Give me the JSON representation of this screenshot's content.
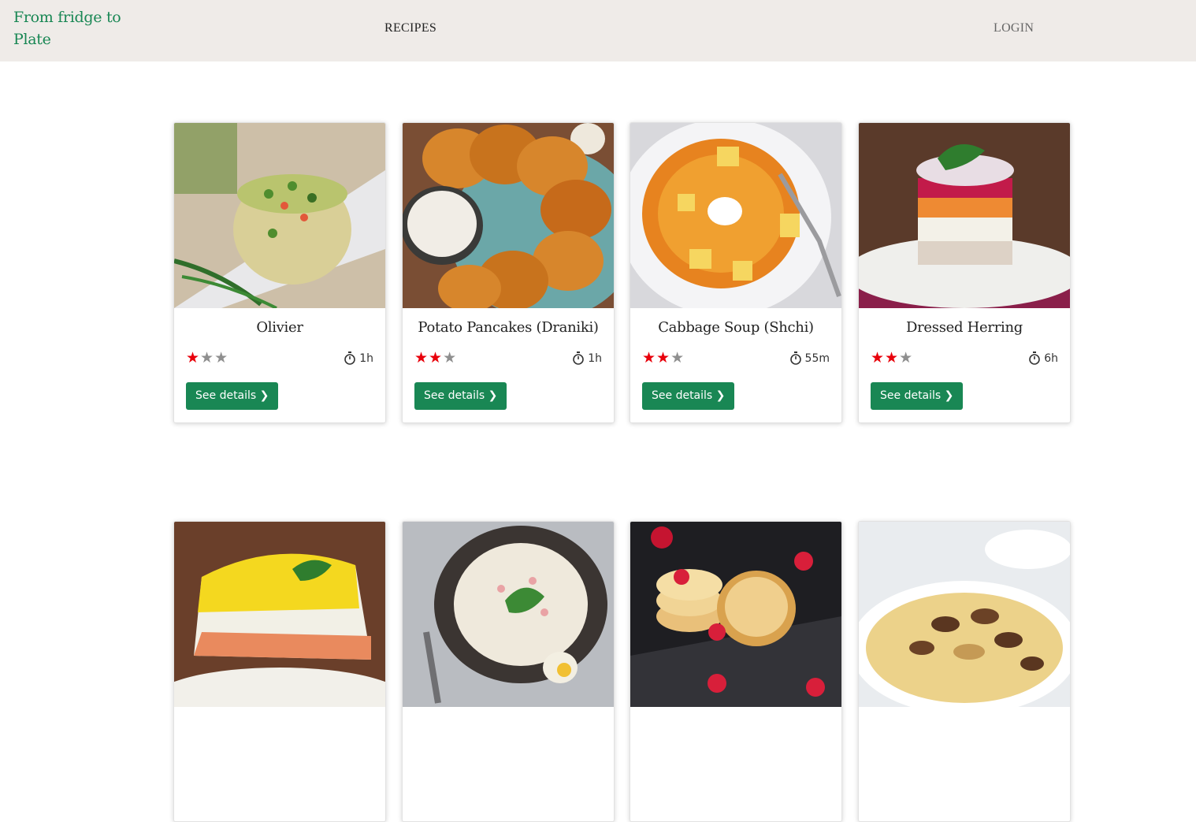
{
  "nav": {
    "brand": "From fridge to Plate",
    "recipes": "RECIPES",
    "login": "LOGIN"
  },
  "button_label": "See details ❯",
  "recipes": [
    {
      "title": "Olivier",
      "rating": 1,
      "max_rating": 3,
      "time": "1h",
      "image": "olivier salad"
    },
    {
      "title": "Potato Pancakes (Draniki)",
      "rating": 2,
      "max_rating": 3,
      "time": "1h",
      "image": "potato pancakes"
    },
    {
      "title": "Cabbage Soup (Shchi)",
      "rating": 2,
      "max_rating": 3,
      "time": "55m",
      "image": "cabbage soup"
    },
    {
      "title": "Dressed Herring",
      "rating": 2,
      "max_rating": 3,
      "time": "6h",
      "image": "layered herring salad"
    },
    {
      "title": "",
      "image": "mimosa salad"
    },
    {
      "title": "",
      "image": "okroshka soup"
    },
    {
      "title": "",
      "image": "syrniki with raspberries"
    },
    {
      "title": "",
      "image": "beef stroganoff"
    }
  ],
  "colors": {
    "brand": "#198754",
    "navbar_bg": "#efebe8",
    "star_on": "#e8000b",
    "star_off": "#8f8f8f"
  }
}
